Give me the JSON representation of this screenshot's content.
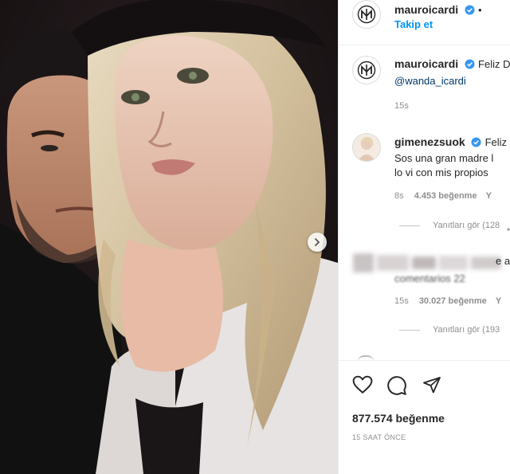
{
  "post": {
    "author": "mauroicardi",
    "follow_label": "Takip et",
    "caption_text": "Feliz D",
    "caption_mention": "@wanda_icardi",
    "caption_time": "15s"
  },
  "comments": [
    {
      "user": "gimenezsuok",
      "first_text": "Feliz",
      "line2": "Sos una gran madre l",
      "line3": "lo vi con mis propios",
      "time": "8s",
      "likes": "4.453 beğenme",
      "reply_short": "Y",
      "view_replies": "Yanıtları gör (128"
    },
    {
      "text_fragment": "e a",
      "line2": "comentarios 22",
      "time": "15s",
      "likes": "30.027 beğenme",
      "reply_short": "Y",
      "view_replies": "Yanıtları gör (193"
    }
  ],
  "footer": {
    "likes": "877.574 beğenme",
    "time_ago": "15 SAAT ÖNCE"
  },
  "colors": {
    "link": "#0095f6",
    "verified": "#3897f0",
    "text": "#262626",
    "muted": "#8e8e8e"
  }
}
